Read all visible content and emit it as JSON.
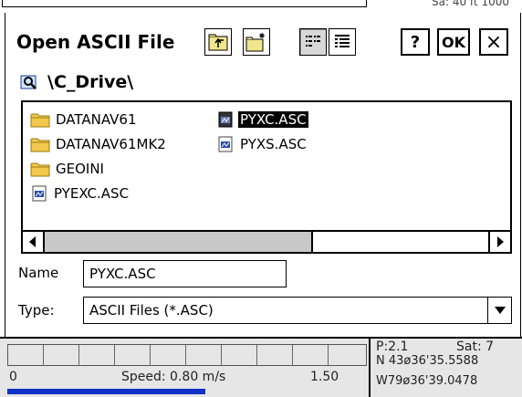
{
  "background": {
    "top_partial_text": "Sa:  40 ft   1000"
  },
  "dialog": {
    "title": "Open ASCII File",
    "help_label": "?",
    "ok_label": "OK",
    "close_label": "×",
    "toolbar_icons": [
      "folder-up-icon",
      "new-folder-icon",
      "list-view-icon",
      "details-view-icon"
    ],
    "path": "\\C_Drive\\",
    "files": [
      {
        "name": "DATANAV61",
        "type": "folder"
      },
      {
        "name": "DATANAV61MK2",
        "type": "folder"
      },
      {
        "name": "GEOINI",
        "type": "folder"
      },
      {
        "name": "PYEXC.ASC",
        "type": "file"
      },
      {
        "name": "PYXC.ASC",
        "type": "file",
        "selected": true
      },
      {
        "name": "PYXS.ASC",
        "type": "file"
      }
    ],
    "name_label": "Name",
    "name_value": "PYXC.ASC",
    "type_label": "Type:",
    "type_value": "ASCII Files (*.ASC)"
  },
  "status": {
    "left_value": "0",
    "speed_text": "Speed: 0.80 m/s",
    "right_value": "1.50",
    "progress_fraction": 0.55,
    "p_text": "P:2.1",
    "sat_text": "Sat:  7",
    "lat_text": "N 43ø36'35.5588",
    "lon_text": "W79ø36'39.0478"
  }
}
